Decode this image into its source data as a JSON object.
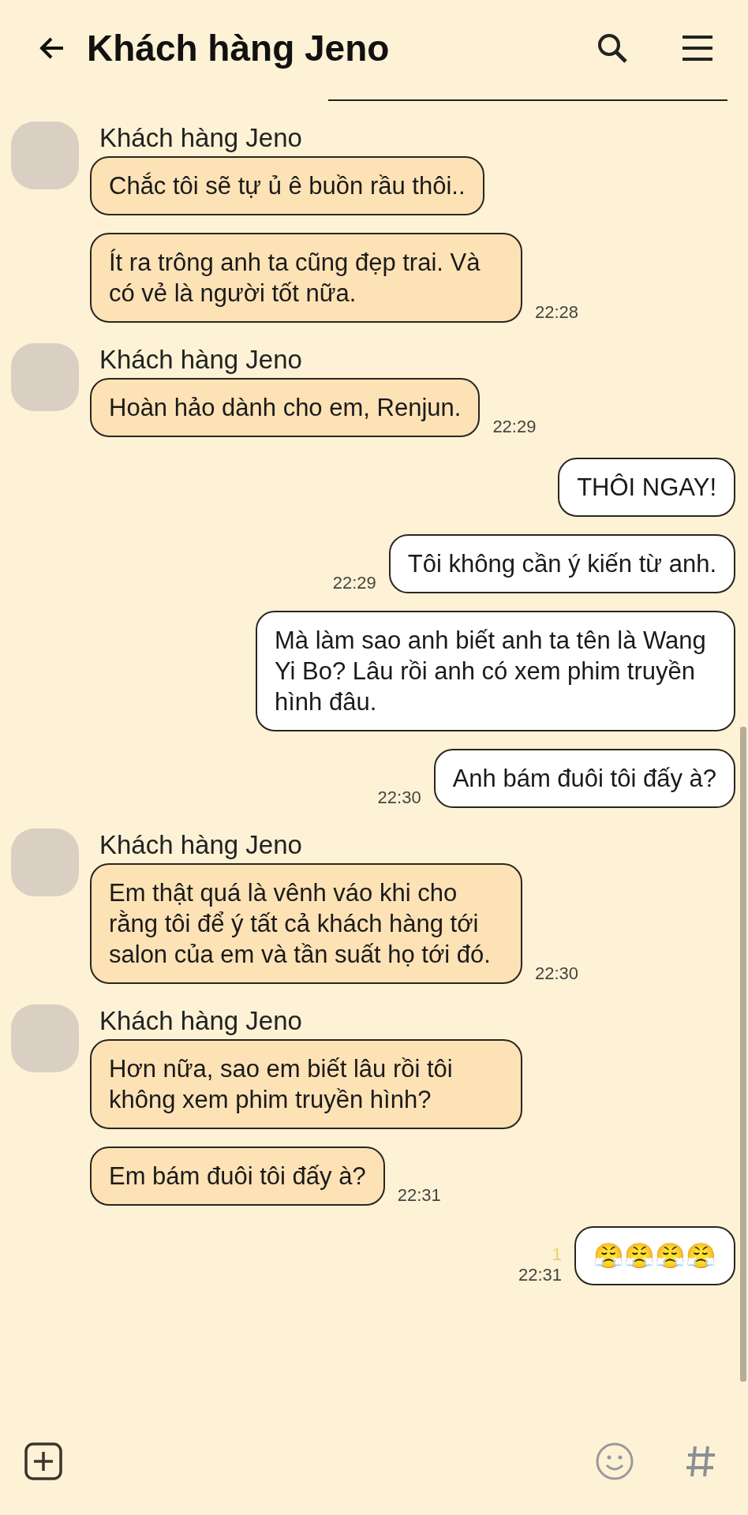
{
  "header": {
    "title": "Khách hàng Jeno"
  },
  "messages": [
    {
      "kind": "incoming",
      "sender": "Khách hàng Jeno",
      "bubbles": [
        {
          "text": "Chắc tôi sẽ tự ủ ê buồn rầu thôi.."
        },
        {
          "text": "Ít ra trông anh ta cũng đẹp trai. Và có vẻ là người tốt nữa.",
          "time": "22:28"
        }
      ]
    },
    {
      "kind": "incoming",
      "sender": "Khách hàng Jeno",
      "bubbles": [
        {
          "text": "Hoàn hảo dành cho em, Renjun.",
          "time": "22:29"
        }
      ]
    },
    {
      "kind": "outgoing",
      "bubbles": [
        {
          "text": "THÔI NGAY!"
        },
        {
          "text": "Tôi không cần ý kiến từ anh.",
          "time": "22:29"
        },
        {
          "text": "Mà làm sao anh biết anh ta tên là Wang Yi Bo? Lâu rồi anh có xem phim truyền hình đâu."
        },
        {
          "text": "Anh bám đuôi tôi đấy à?",
          "time": "22:30"
        }
      ]
    },
    {
      "kind": "incoming",
      "sender": "Khách hàng Jeno",
      "bubbles": [
        {
          "text": "Em thật quá là vênh váo khi cho rằng tôi để ý tất cả khách hàng tới salon của em và tần suất họ tới đó.",
          "time": "22:30"
        }
      ]
    },
    {
      "kind": "incoming",
      "sender": "Khách hàng Jeno",
      "bubbles": [
        {
          "text": "Hơn nữa, sao em biết lâu rồi tôi không xem phim truyền hình?"
        },
        {
          "text": "Em bám đuôi tôi đấy à?",
          "time": "22:31"
        }
      ]
    },
    {
      "kind": "outgoing",
      "bubbles": [
        {
          "text": "😤😤😤😤",
          "unread": "1",
          "time": "22:31"
        }
      ]
    }
  ]
}
